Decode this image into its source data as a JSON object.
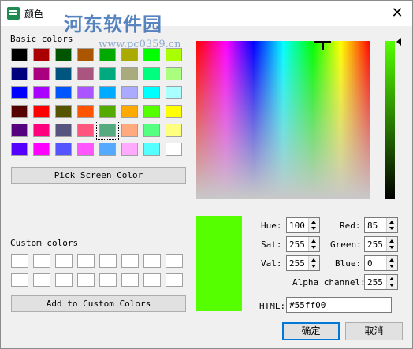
{
  "window": {
    "title": "颜色",
    "close_glyph": "✕"
  },
  "watermark": {
    "text": "河东软件园",
    "url": "www.pc0359.cn"
  },
  "basic": {
    "label": "Basic colors",
    "selected_index": 36,
    "colors": [
      "#000000",
      "#aa0000",
      "#005500",
      "#aa5500",
      "#00aa00",
      "#aaaa00",
      "#00ff00",
      "#aaff00",
      "#00007f",
      "#aa007f",
      "#00557f",
      "#aa557f",
      "#00aa7f",
      "#aaaa7f",
      "#00ff7f",
      "#aaff7f",
      "#0000ff",
      "#aa00ff",
      "#0055ff",
      "#aa55ff",
      "#00aaff",
      "#aaaaff",
      "#00ffff",
      "#aaffff",
      "#550000",
      "#ff0000",
      "#555500",
      "#ff5500",
      "#55aa00",
      "#ffaa00",
      "#55ff00",
      "#ffff00",
      "#55007f",
      "#ff007f",
      "#55557f",
      "#ff557f",
      "#55aa7f",
      "#ffaa7f",
      "#55ff7f",
      "#ffff7f",
      "#5500ff",
      "#ff00ff",
      "#5555ff",
      "#ff55ff",
      "#55aaff",
      "#ffaaff",
      "#55ffff",
      "#ffffff"
    ]
  },
  "pick_screen_label": "Pick Screen Color",
  "custom": {
    "label": "Custom colors",
    "count": 16
  },
  "add_custom_label": "Add to Custom Colors",
  "current_color": "#55ff00",
  "fields": {
    "hue": {
      "label": "Hue:",
      "value": "100"
    },
    "sat": {
      "label": "Sat:",
      "value": "255"
    },
    "val": {
      "label": "Val:",
      "value": "255"
    },
    "red": {
      "label": "Red:",
      "value": "85"
    },
    "green": {
      "label": "Green:",
      "value": "255"
    },
    "blue": {
      "label": "Blue:",
      "value": "0"
    },
    "alpha": {
      "label": "Alpha channel:",
      "value": "255"
    },
    "html": {
      "label": "HTML:",
      "value": "#55ff00"
    }
  },
  "buttons": {
    "ok": "确定",
    "cancel": "取消"
  }
}
